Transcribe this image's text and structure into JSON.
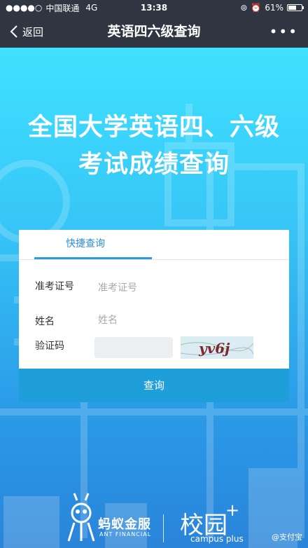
{
  "status_bar": {
    "signal": "●●●●○",
    "carrier": "中国联通",
    "network": "4G",
    "time": "13:38",
    "battery_percent": "61%",
    "battery_level": 0.61
  },
  "navbar": {
    "back_label": "返回",
    "title": "英语四六级查询",
    "more": "•••"
  },
  "hero": {
    "title_line1": "全国大学英语四、六级",
    "title_line2": "考试成绩查询"
  },
  "form": {
    "tab_label": "快捷查询",
    "exam_id_label": "准考证号",
    "exam_id_placeholder": "准考证号",
    "name_label": "姓名",
    "name_placeholder": "姓名",
    "captcha_label": "验证码",
    "captcha_text": "yv6j",
    "submit_label": "查询"
  },
  "footer": {
    "ant_name": "蚂蚁金服",
    "ant_sub": "ANT FINANCIAL",
    "campus_name": "校园",
    "campus_plus": "+",
    "campus_sub": "campus plus",
    "watermark": "@支付宝"
  },
  "colors": {
    "accent": "#2a9be0",
    "button": "#1e9fd9",
    "nav_bg": "#2f3642"
  }
}
